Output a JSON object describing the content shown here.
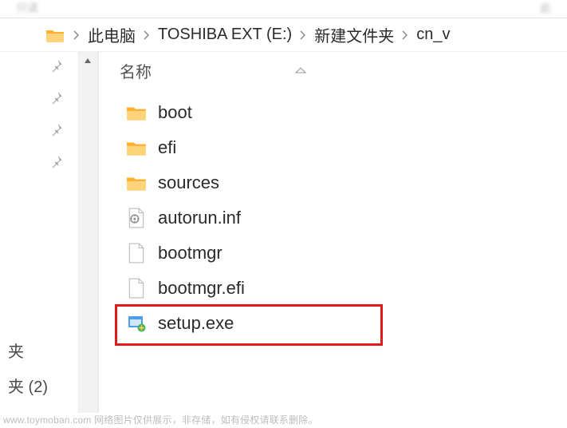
{
  "topbar": {
    "left_blur": "只读",
    "right_blur": "此"
  },
  "breadcrumb": {
    "items": [
      "此电脑",
      "TOSHIBA EXT (E:)",
      "新建文件夹",
      "cn_v"
    ]
  },
  "columns": {
    "name_header": "名称"
  },
  "nav": {
    "label1": "夹",
    "label2": "夹 (2)"
  },
  "files": [
    {
      "name": "boot",
      "type": "folder"
    },
    {
      "name": "efi",
      "type": "folder"
    },
    {
      "name": "sources",
      "type": "folder"
    },
    {
      "name": "autorun.inf",
      "type": "inf"
    },
    {
      "name": "bootmgr",
      "type": "file"
    },
    {
      "name": "bootmgr.efi",
      "type": "file"
    },
    {
      "name": "setup.exe",
      "type": "exe"
    }
  ],
  "highlight_index": 6,
  "watermark": "www.toymoban.com 网络图片仅供展示，非存储，如有侵权请联系删除。"
}
